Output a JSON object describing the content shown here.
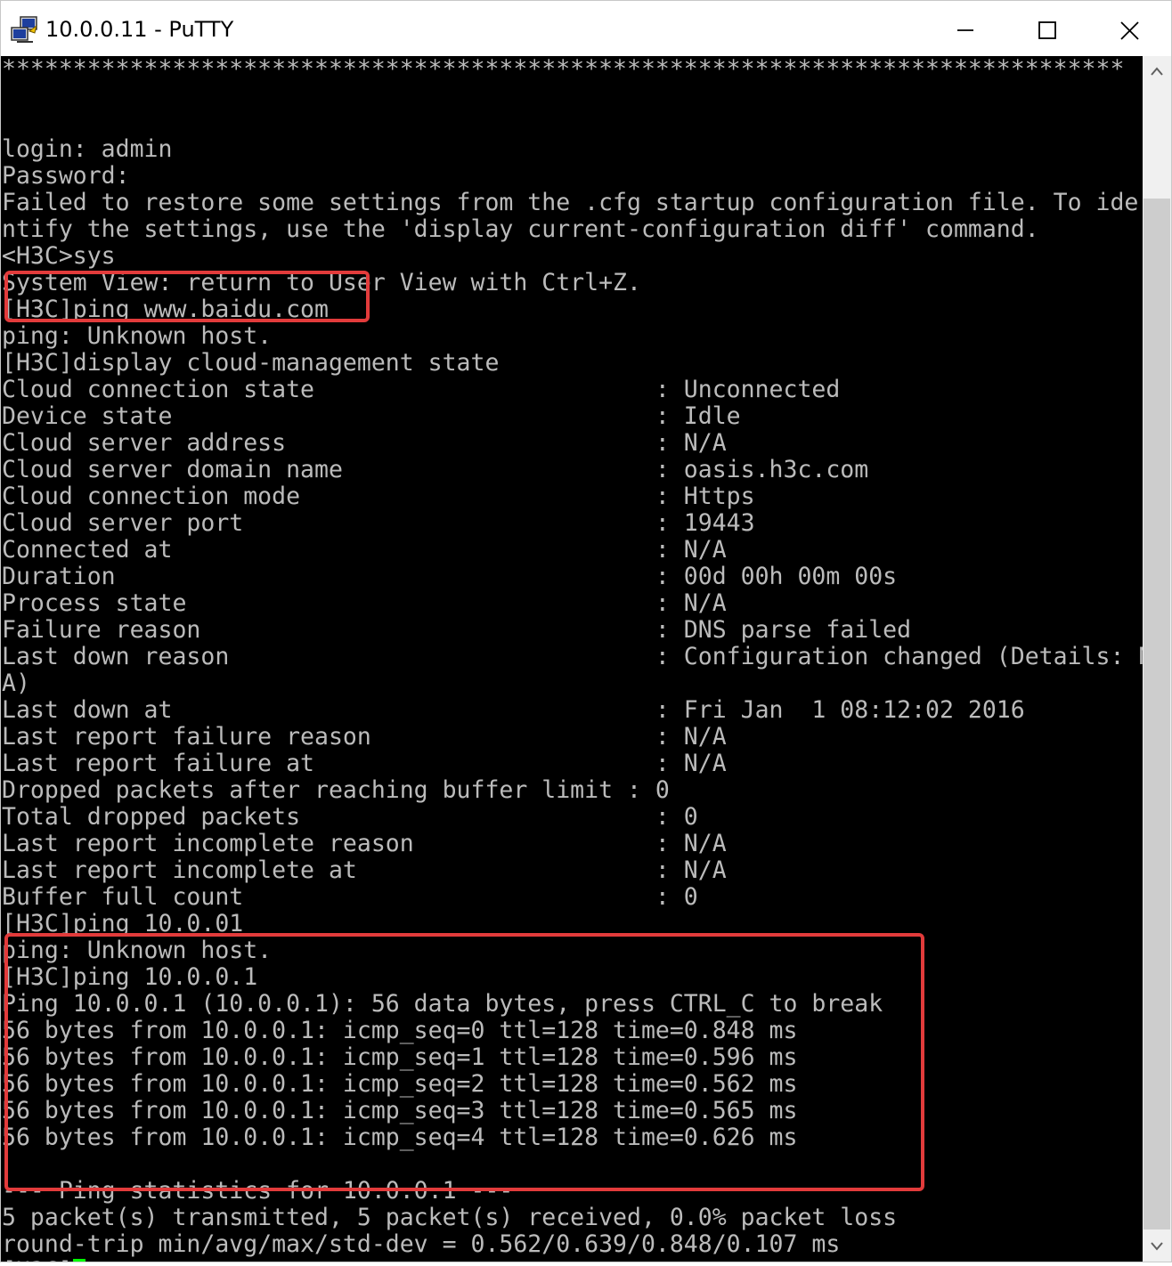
{
  "window": {
    "title": "10.0.0.11 - PuTTY",
    "icon": "putty-app-icon",
    "controls": {
      "minimize_icon": "minimize-icon",
      "maximize_icon": "maximize-icon",
      "close_icon": "close-icon"
    }
  },
  "terminal": {
    "colors": {
      "background": "#000000",
      "text": "#bbbbbb",
      "cursor": "#00ff00",
      "highlight": "#e23b3b"
    },
    "lines": [
      "*******************************************************************************",
      "",
      "",
      "login: admin",
      "Password:",
      "Failed to restore some settings from the .cfg startup configuration file. To ide",
      "ntify the settings, use the 'display current-configuration diff' command.",
      "<H3C>sys",
      "System View: return to User View with Ctrl+Z.",
      "[H3C]ping www.baidu.com",
      "ping: Unknown host.",
      "[H3C]display cloud-management state",
      "Cloud connection state                        : Unconnected",
      "Device state                                  : Idle",
      "Cloud server address                          : N/A",
      "Cloud server domain name                      : oasis.h3c.com",
      "Cloud connection mode                         : Https",
      "Cloud server port                             : 19443",
      "Connected at                                  : N/A",
      "Duration                                      : 00d 00h 00m 00s",
      "Process state                                 : N/A",
      "Failure reason                                : DNS parse failed",
      "Last down reason                              : Configuration changed (Details: N/",
      "A)",
      "Last down at                                  : Fri Jan  1 08:12:02 2016",
      "Last report failure reason                    : N/A",
      "Last report failure at                        : N/A",
      "Dropped packets after reaching buffer limit : 0",
      "Total dropped packets                         : 0",
      "Last report incomplete reason                 : N/A",
      "Last report incomplete at                     : N/A",
      "Buffer full count                             : 0",
      "[H3C]ping 10.0.01",
      "ping: Unknown host.",
      "[H3C]ping 10.0.0.1",
      "Ping 10.0.0.1 (10.0.0.1): 56 data bytes, press CTRL_C to break",
      "56 bytes from 10.0.0.1: icmp_seq=0 ttl=128 time=0.848 ms",
      "56 bytes from 10.0.0.1: icmp_seq=1 ttl=128 time=0.596 ms",
      "56 bytes from 10.0.0.1: icmp_seq=2 ttl=128 time=0.562 ms",
      "56 bytes from 10.0.0.1: icmp_seq=3 ttl=128 time=0.565 ms",
      "56 bytes from 10.0.0.1: icmp_seq=4 ttl=128 time=0.626 ms",
      "",
      "--- Ping statistics for 10.0.0.1 ---",
      "5 packet(s) transmitted, 5 packet(s) received, 0.0% packet loss",
      "round-trip min/avg/max/std-dev = 0.562/0.639/0.848/0.107 ms"
    ],
    "prompt": "[H3C]"
  },
  "scrollbar": {
    "up_icon": "scroll-up-arrow-icon",
    "down_icon": "scroll-down-arrow-icon"
  }
}
